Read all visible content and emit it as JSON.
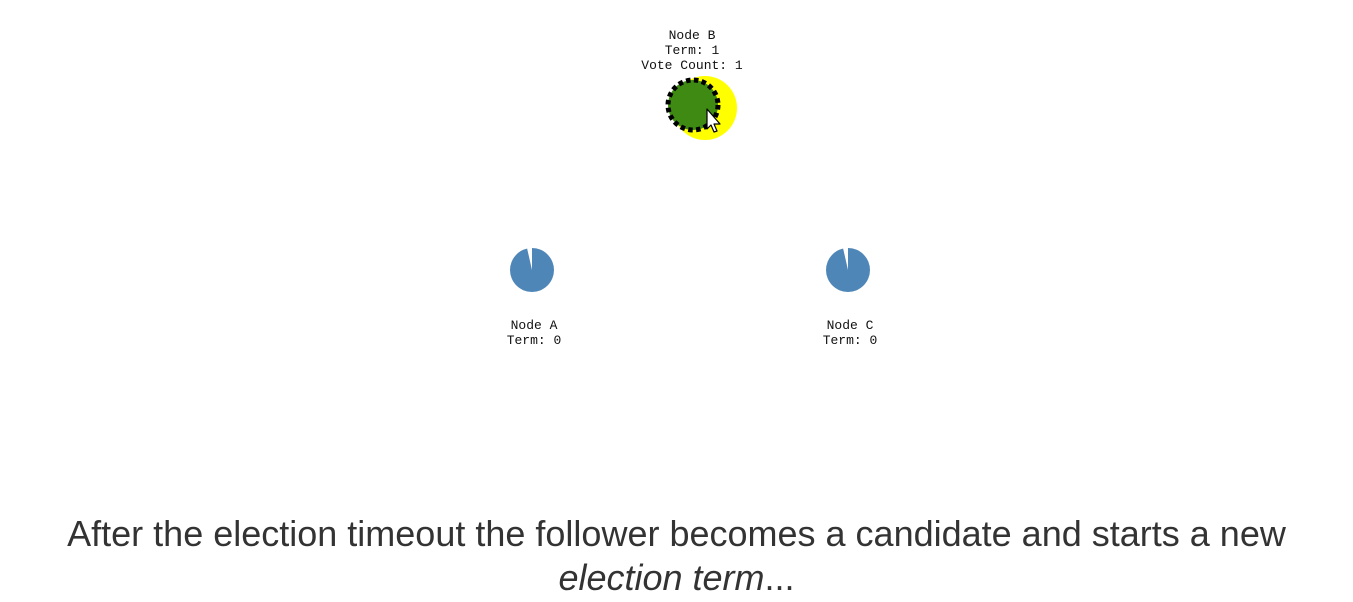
{
  "nodes": {
    "b": {
      "name": "Node B",
      "term": "Term: 1",
      "vote_count": "Vote Count: 1",
      "state": "candidate",
      "fill": "#3f8a12",
      "highlight": "#ffff00",
      "border": "#000000"
    },
    "a": {
      "name": "Node A",
      "term": "Term: 0",
      "state": "follower",
      "fill": "#4f86b8"
    },
    "c": {
      "name": "Node C",
      "term": "Term: 0",
      "state": "follower",
      "fill": "#4f86b8"
    }
  },
  "caption": {
    "line1": "After the election timeout the follower becomes a candidate and starts a new",
    "emphasis": "election term",
    "suffix": "..."
  },
  "colors": {
    "text": "#333333"
  }
}
